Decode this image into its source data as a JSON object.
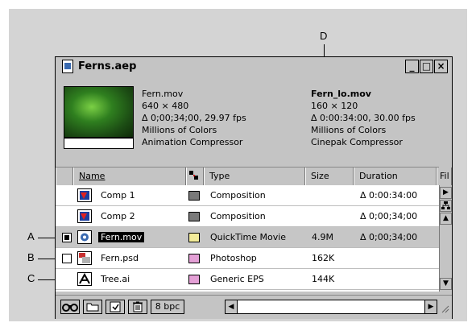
{
  "callouts": {
    "a": "A",
    "b": "B",
    "c": "C",
    "d": "D"
  },
  "window": {
    "title": "Ferns.aep",
    "btn_min": "_",
    "btn_max": "□",
    "btn_close": "×"
  },
  "left_info": {
    "name": "Fern.mov",
    "dims": "640 × 480",
    "timing": "Δ 0;00;34;00, 29.97 fps",
    "colors": "Millions of Colors",
    "compressor": "Animation Compressor"
  },
  "right_info": {
    "name": "Fern_lo.mov",
    "dims": "160 × 120",
    "timing": "Δ 0:00:34:00, 30.00 fps",
    "colors": "Millions of Colors",
    "compressor": "Cinepak Compressor"
  },
  "columns": {
    "name": "Name",
    "type": "Type",
    "size": "Size",
    "duration": "Duration",
    "file": "Fil"
  },
  "rows": [
    {
      "name": "Comp 1",
      "type": "Composition",
      "size": "",
      "duration": "Δ 0:00:34:00",
      "label_color": "#7a7a7a",
      "icon": "composition-icon"
    },
    {
      "name": "Comp 2",
      "type": "Composition",
      "size": "",
      "duration": "Δ 0;00;34;00",
      "label_color": "#7a7a7a",
      "icon": "composition-icon"
    },
    {
      "name": "Fern.mov",
      "type": "QuickTime Movie",
      "size": "4.9M",
      "duration": "Δ 0;00;34;00",
      "label_color": "#f3ec9a",
      "icon": "quicktime-icon"
    },
    {
      "name": "Fern.psd",
      "type": "Photoshop",
      "size": "162K",
      "duration": "",
      "label_color": "#e4a0d6",
      "icon": "photoshop-icon"
    },
    {
      "name": "Tree.ai",
      "type": "Generic EPS",
      "size": "144K",
      "duration": "",
      "label_color": "#e4a0d6",
      "icon": "illustrator-icon"
    }
  ],
  "toolbar": {
    "bpc": "8 bpc"
  }
}
